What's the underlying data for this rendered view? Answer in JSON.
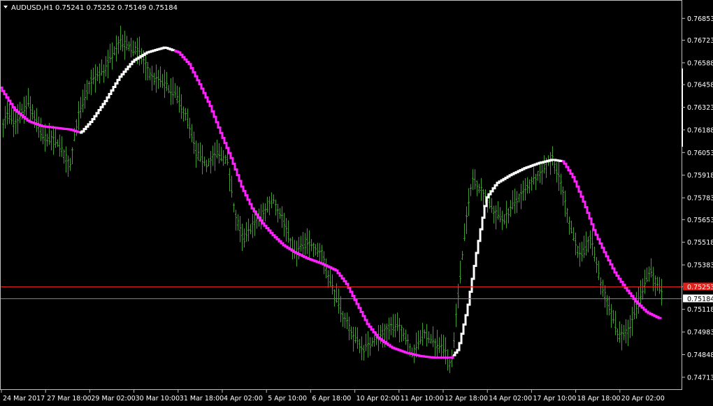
{
  "window": {
    "symbol": "AUDUSD,H1",
    "ohlc": "0.75241 0.75252 0.75149 0.75184"
  },
  "colors": {
    "background": "#000000",
    "axis": "#c0c0c0",
    "bars": "#3e9e2b",
    "ma_up": "#ffffff",
    "ma_down": "#ff22ff",
    "ask_line": "#e0201a",
    "bid_line": "#808080",
    "label_text": "#000000",
    "label_bg": "#ffffff"
  },
  "icons": {
    "menu": "triangle-down-icon"
  },
  "chart_data": {
    "type": "line",
    "title": "AUDUSD,H1",
    "ylim": [
      0.7465,
      0.769
    ],
    "y_ticks": [
      "0.76853",
      "0.76723",
      "0.76588",
      "0.76458",
      "0.76323",
      "0.76188",
      "0.76053",
      "0.75918",
      "0.75783",
      "0.75653",
      "0.75518",
      "0.75383",
      "0.75253",
      "0.75118",
      "0.74983",
      "0.74848",
      "0.74713"
    ],
    "x_ticks": [
      "24 Mar 2017",
      "27 Mar 18:00",
      "29 Mar 02:00",
      "30 Mar 10:00",
      "31 Mar 18:00",
      "4 Apr 02:00",
      "5 Apr 10:00",
      "6 Apr 18:00",
      "10 Apr 02:00",
      "11 Apr 10:00",
      "12 Apr 18:00",
      "14 Apr 02:00",
      "17 Apr 10:00",
      "18 Apr 18:00",
      "20 Apr 02:00"
    ],
    "grid": false,
    "legend": "none",
    "price_lines": {
      "ask": "0.75253",
      "bid": "0.75184"
    },
    "series": [
      {
        "kind": "price",
        "key_points": [
          [
            0,
            0.762
          ],
          [
            10,
            0.7628
          ],
          [
            20,
            0.7622
          ],
          [
            40,
            0.7635
          ],
          [
            60,
            0.7615
          ],
          [
            80,
            0.7612
          ],
          [
            100,
            0.7598
          ],
          [
            110,
            0.7625
          ],
          [
            130,
            0.7648
          ],
          [
            150,
            0.7655
          ],
          [
            170,
            0.7672
          ],
          [
            185,
            0.7668
          ],
          [
            200,
            0.7665
          ],
          [
            215,
            0.765
          ],
          [
            230,
            0.7648
          ],
          [
            250,
            0.764
          ],
          [
            265,
            0.7628
          ],
          [
            280,
            0.7605
          ],
          [
            295,
            0.7598
          ],
          [
            310,
            0.7605
          ],
          [
            325,
            0.76
          ],
          [
            335,
            0.757
          ],
          [
            348,
            0.7552
          ],
          [
            360,
            0.7562
          ],
          [
            375,
            0.7568
          ],
          [
            390,
            0.7578
          ],
          [
            405,
            0.7565
          ],
          [
            420,
            0.7545
          ],
          [
            440,
            0.7552
          ],
          [
            460,
            0.7545
          ],
          [
            475,
            0.7525
          ],
          [
            490,
            0.7508
          ],
          [
            505,
            0.7496
          ],
          [
            520,
            0.7488
          ],
          [
            540,
            0.7495
          ],
          [
            560,
            0.7502
          ],
          [
            575,
            0.75
          ],
          [
            590,
            0.7485
          ],
          [
            605,
            0.7498
          ],
          [
            620,
            0.7492
          ],
          [
            635,
            0.7488
          ],
          [
            645,
            0.7478
          ],
          [
            655,
            0.752
          ],
          [
            665,
            0.756
          ],
          [
            675,
            0.759
          ],
          [
            690,
            0.7582
          ],
          [
            705,
            0.757
          ],
          [
            720,
            0.7565
          ],
          [
            735,
            0.7575
          ],
          [
            750,
            0.7582
          ],
          [
            765,
            0.759
          ],
          [
            780,
            0.7598
          ],
          [
            790,
            0.7602
          ],
          [
            800,
            0.759
          ],
          [
            815,
            0.7562
          ],
          [
            830,
            0.7542
          ],
          [
            845,
            0.7555
          ],
          [
            858,
            0.7528
          ],
          [
            870,
            0.7515
          ],
          [
            885,
            0.7495
          ],
          [
            900,
            0.75
          ],
          [
            915,
            0.752
          ],
          [
            930,
            0.7535
          ],
          [
            945,
            0.7522
          ]
        ]
      },
      {
        "kind": "moving_average",
        "key_points": [
          [
            0,
            0.7644
          ],
          [
            20,
            0.7631
          ],
          [
            40,
            0.7624
          ],
          [
            60,
            0.7621
          ],
          [
            80,
            0.762
          ],
          [
            100,
            0.7619
          ],
          [
            115,
            0.7617
          ],
          [
            130,
            0.7624
          ],
          [
            150,
            0.7636
          ],
          [
            170,
            0.765
          ],
          [
            190,
            0.766
          ],
          [
            210,
            0.7665
          ],
          [
            235,
            0.7668
          ],
          [
            255,
            0.7665
          ],
          [
            270,
            0.7658
          ],
          [
            285,
            0.7646
          ],
          [
            300,
            0.7633
          ],
          [
            315,
            0.7617
          ],
          [
            330,
            0.7602
          ],
          [
            345,
            0.7585
          ],
          [
            360,
            0.7572
          ],
          [
            375,
            0.7563
          ],
          [
            390,
            0.7556
          ],
          [
            405,
            0.755
          ],
          [
            420,
            0.7546
          ],
          [
            440,
            0.7542
          ],
          [
            460,
            0.7539
          ],
          [
            480,
            0.7535
          ],
          [
            495,
            0.7527
          ],
          [
            510,
            0.7515
          ],
          [
            525,
            0.7503
          ],
          [
            540,
            0.7495
          ],
          [
            560,
            0.7489
          ],
          [
            580,
            0.7486
          ],
          [
            600,
            0.7484
          ],
          [
            620,
            0.7483
          ],
          [
            645,
            0.7483
          ],
          [
            655,
            0.7488
          ],
          [
            668,
            0.7512
          ],
          [
            682,
            0.7548
          ],
          [
            695,
            0.7578
          ],
          [
            710,
            0.7587
          ],
          [
            730,
            0.7592
          ],
          [
            750,
            0.7596
          ],
          [
            770,
            0.7599
          ],
          [
            790,
            0.7601
          ],
          [
            805,
            0.76
          ],
          [
            820,
            0.759
          ],
          [
            835,
            0.7575
          ],
          [
            850,
            0.7558
          ],
          [
            865,
            0.7545
          ],
          [
            880,
            0.7533
          ],
          [
            895,
            0.7524
          ],
          [
            910,
            0.7516
          ],
          [
            925,
            0.751
          ],
          [
            945,
            0.7506
          ]
        ],
        "up_ranges": [
          [
            115,
            250
          ],
          [
            650,
            805
          ]
        ]
      }
    ]
  }
}
